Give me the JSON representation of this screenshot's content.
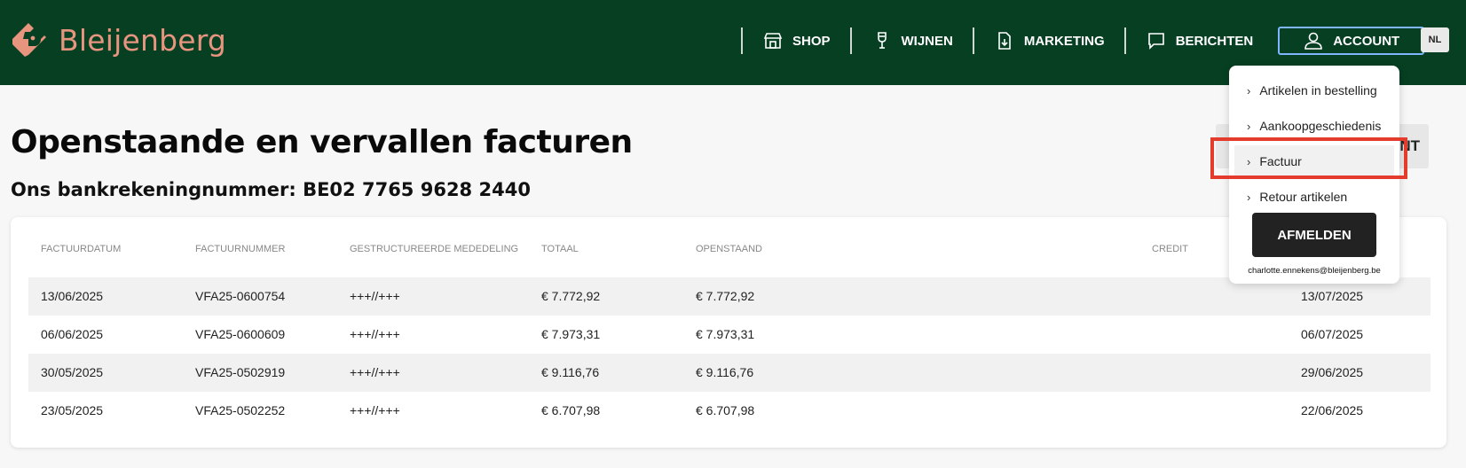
{
  "brand": {
    "name": "Bleijenberg",
    "color": "#e7957f"
  },
  "nav": {
    "items": [
      {
        "label": "SHOP",
        "icon": "shop-icon"
      },
      {
        "label": "WIJNEN",
        "icon": "wine-glass-icon"
      },
      {
        "label": "MARKETING",
        "icon": "download-doc-icon"
      },
      {
        "label": "BERICHTEN",
        "icon": "message-icon"
      },
      {
        "label": "ACCOUNT",
        "icon": "user-icon"
      }
    ],
    "language": "NL"
  },
  "page": {
    "title": "Openstaande en vervallen facturen",
    "bank_account": "Ons bankrekeningnummer: BE02 7765 9628 2440",
    "hidden_button_label": "ENT"
  },
  "table": {
    "columns": [
      "FACTUURDATUM",
      "FACTUURNUMMER",
      "GESTRUCTUREERDE MEDEDELING",
      "TOTAAL",
      "OPENSTAAND",
      "CREDIT"
    ],
    "rows": [
      {
        "date": "13/06/2025",
        "number": "VFA25-0600754",
        "comm": "+++//+++",
        "total": "€ 7.772,92",
        "open": "€ 7.772,92",
        "due": "13/07/2025"
      },
      {
        "date": "06/06/2025",
        "number": "VFA25-0600609",
        "comm": "+++//+++",
        "total": "€ 7.973,31",
        "open": "€ 7.973,31",
        "due": "06/07/2025"
      },
      {
        "date": "30/05/2025",
        "number": "VFA25-0502919",
        "comm": "+++//+++",
        "total": "€ 9.116,76",
        "open": "€ 9.116,76",
        "due": "29/06/2025"
      },
      {
        "date": "23/05/2025",
        "number": "VFA25-0502252",
        "comm": "+++//+++",
        "total": "€ 6.707,98",
        "open": "€ 6.707,98",
        "due": "22/06/2025"
      }
    ]
  },
  "account_menu": {
    "items": [
      "Artikelen in bestelling",
      "Aankoopgeschiedenis",
      "Factuur",
      "Retour artikelen"
    ],
    "logout": "AFMELDEN",
    "email": "charlotte.ennekens@bleijenberg.be"
  },
  "colors": {
    "header": "#063f22",
    "highlight": "#e33b2c"
  }
}
